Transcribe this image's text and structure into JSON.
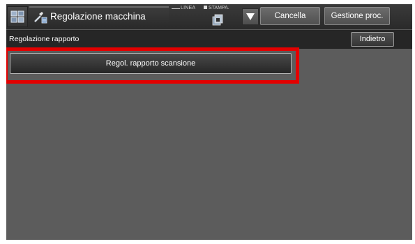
{
  "header": {
    "mode_title": "Regolazione macchina",
    "status_line": "LINEA",
    "status_print": "STAMPA.",
    "cancel_label": "Cancella",
    "job_manager_label": "Gestione proc."
  },
  "subheader": {
    "title": "Regolazione rapporto",
    "back_label": "Indietro"
  },
  "main": {
    "scan_ratio_label": "Regol. rapporto scansione"
  },
  "icons": {
    "home": "home-icon",
    "settings": "machine-adjust-icon",
    "job": "job-status-icon",
    "dropdown": "triangle-down-icon"
  },
  "colors": {
    "highlight": "#e40000",
    "background": "#5c5c5c",
    "subheader": "#262626"
  }
}
